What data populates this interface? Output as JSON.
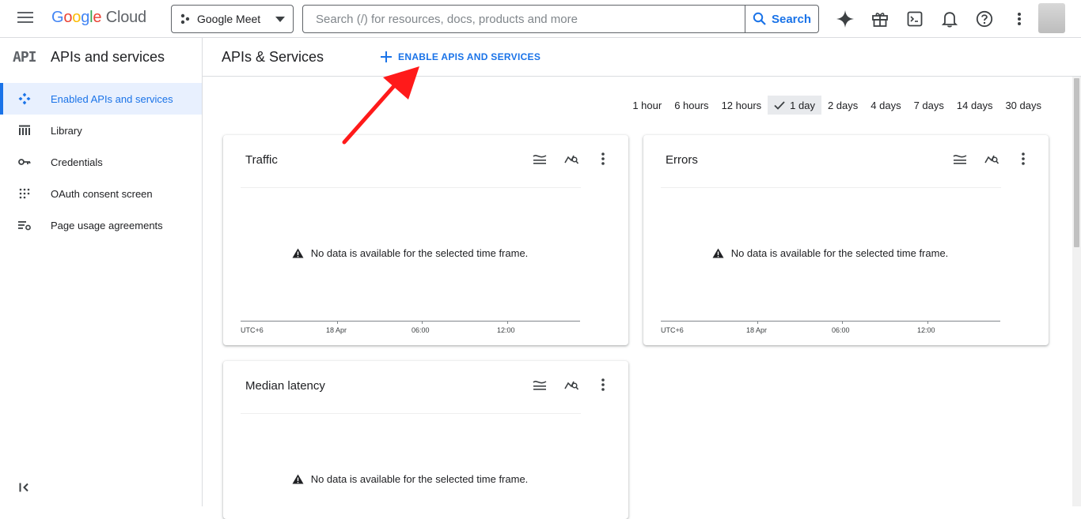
{
  "topbar": {
    "logo": {
      "google": [
        "G",
        "o",
        "o",
        "g",
        "l",
        "e"
      ],
      "cloud": "Cloud"
    },
    "project": "Google Meet",
    "search_placeholder": "Search (/) for resources, docs, products and more",
    "search_button": "Search",
    "icons": [
      "gemini-icon",
      "gift-icon",
      "terminal-icon",
      "bell-icon",
      "help-icon",
      "more-vert-icon"
    ]
  },
  "sidebar": {
    "api_glyph": "API",
    "title": "APIs and services",
    "items": [
      {
        "label": "Enabled APIs and services",
        "icon": "enabled-apis-icon",
        "active": true
      },
      {
        "label": "Library",
        "icon": "library-icon",
        "active": false
      },
      {
        "label": "Credentials",
        "icon": "key-icon",
        "active": false
      },
      {
        "label": "OAuth consent screen",
        "icon": "oauth-icon",
        "active": false
      },
      {
        "label": "Page usage agreements",
        "icon": "settings-list-icon",
        "active": false
      }
    ]
  },
  "main": {
    "title": "APIs & Services",
    "enable_button": "ENABLE APIS AND SERVICES",
    "time_ranges": [
      "1 hour",
      "6 hours",
      "12 hours",
      "1 day",
      "2 days",
      "4 days",
      "7 days",
      "14 days",
      "30 days"
    ],
    "selected_time_range": "1 day",
    "cards": [
      {
        "title": "Traffic",
        "no_data": "No data is available for the selected time frame.",
        "axis": [
          "UTC+6",
          "18 Apr",
          "06:00",
          "12:00"
        ]
      },
      {
        "title": "Errors",
        "no_data": "No data is available for the selected time frame.",
        "axis": [
          "UTC+6",
          "18 Apr",
          "06:00",
          "12:00"
        ]
      },
      {
        "title": "Median latency",
        "no_data": "No data is available for the selected time frame."
      }
    ]
  },
  "colors": {
    "accent": "#1a73e8",
    "annotation_arrow": "#ff1a1a"
  }
}
